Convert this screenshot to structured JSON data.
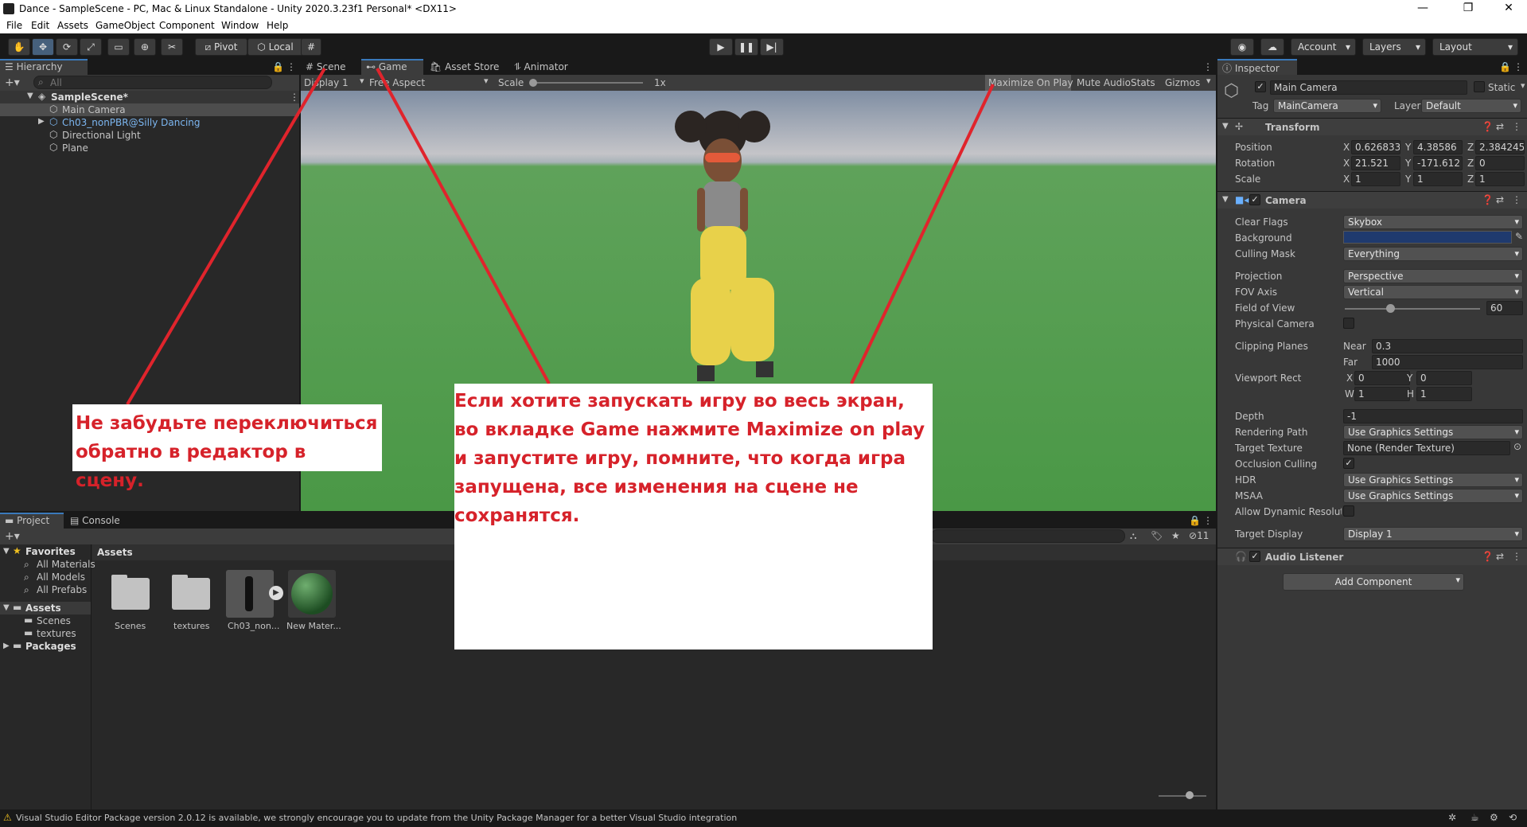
{
  "window": {
    "title": "Dance - SampleScene - PC, Mac & Linux Standalone - Unity 2020.3.23f1 Personal* <DX11>",
    "minimize": "—",
    "restore": "❐",
    "close": "✕"
  },
  "menu": [
    "File",
    "Edit",
    "Assets",
    "GameObject",
    "Component",
    "Window",
    "Help"
  ],
  "toolbar": {
    "pivot": "Pivot",
    "local": "Local",
    "account": "Account",
    "layers": "Layers",
    "layout": "Layout"
  },
  "hierarchy": {
    "tab": "Hierarchy",
    "search_placeholder": "All",
    "scene": "SampleScene*",
    "items": [
      "Main Camera",
      "Ch03_nonPBR@Silly Dancing",
      "Directional Light",
      "Plane"
    ]
  },
  "view": {
    "tabs": [
      "Scene",
      "Game",
      "Asset Store",
      "Animator"
    ],
    "display": "Display 1",
    "aspect": "Free Aspect",
    "scale_label": "Scale",
    "scale_value": "1x",
    "maximize": "Maximize On Play",
    "mute": "Mute Audio",
    "stats": "Stats",
    "gizmos": "Gizmos"
  },
  "project": {
    "tabs": [
      "Project",
      "Console"
    ],
    "count": "11",
    "favorites": "Favorites",
    "fav_items": [
      "All Materials",
      "All Models",
      "All Prefabs"
    ],
    "assets_label": "Assets",
    "assets_children": [
      "Scenes",
      "textures"
    ],
    "packages": "Packages",
    "breadcrumb": "Assets",
    "grid": [
      "Scenes",
      "textures",
      "Ch03_non...",
      "New Mater..."
    ]
  },
  "inspector": {
    "tab": "Inspector",
    "object_name": "Main Camera",
    "static": "Static",
    "tag_label": "Tag",
    "tag": "MainCamera",
    "layer_label": "Layer",
    "layer": "Default",
    "transform": {
      "title": "Transform",
      "position_label": "Position",
      "position": [
        "0.626833",
        "4.38586",
        "2.384245"
      ],
      "rotation_label": "Rotation",
      "rotation": [
        "21.521",
        "-171.612",
        "0"
      ],
      "scale_label": "Scale",
      "scale": [
        "1",
        "1",
        "1"
      ]
    },
    "camera": {
      "title": "Camera",
      "clear_flags_label": "Clear Flags",
      "clear_flags": "Skybox",
      "background_label": "Background",
      "culling_label": "Culling Mask",
      "culling": "Everything",
      "projection_label": "Projection",
      "projection": "Perspective",
      "fov_axis_label": "FOV Axis",
      "fov_axis": "Vertical",
      "fov_label": "Field of View",
      "fov": "60",
      "physical_label": "Physical Camera",
      "clipping_label": "Clipping Planes",
      "near_label": "Near",
      "near": "0.3",
      "far_label": "Far",
      "far": "1000",
      "viewport_label": "Viewport Rect",
      "vx": "0",
      "vy": "0",
      "vw": "1",
      "vh": "1",
      "depth_label": "Depth",
      "depth": "-1",
      "rendering_label": "Rendering Path",
      "rendering": "Use Graphics Settings",
      "target_tex_label": "Target Texture",
      "target_tex": "None (Render Texture)",
      "occlusion_label": "Occlusion Culling",
      "hdr_label": "HDR",
      "hdr": "Use Graphics Settings",
      "msaa_label": "MSAA",
      "msaa": "Use Graphics Settings",
      "dyn_label": "Allow Dynamic Resolutio",
      "target_display_label": "Target Display",
      "target_display": "Display 1"
    },
    "audio_listener": "Audio Listener",
    "add_component": "Add Component"
  },
  "status": "Visual Studio Editor Package version 2.0.12 is available, we strongly encourage you to update from the Unity Package Manager for a better Visual Studio integration",
  "notes": {
    "left": "Не забудьте переключиться обратно в редактор в сцену.",
    "center": "Если хотите запускать игру во весь экран, во вкладке Game нажмите Maximize on play и запустите игру, помните, что когда игра запущена, все изменения на сцене не сохранятся."
  },
  "colors": {
    "accent": "#3a79bb",
    "annotation": "#d6222a",
    "background_swatch": "#1f3a6e",
    "ground": "#4f9a4a"
  }
}
